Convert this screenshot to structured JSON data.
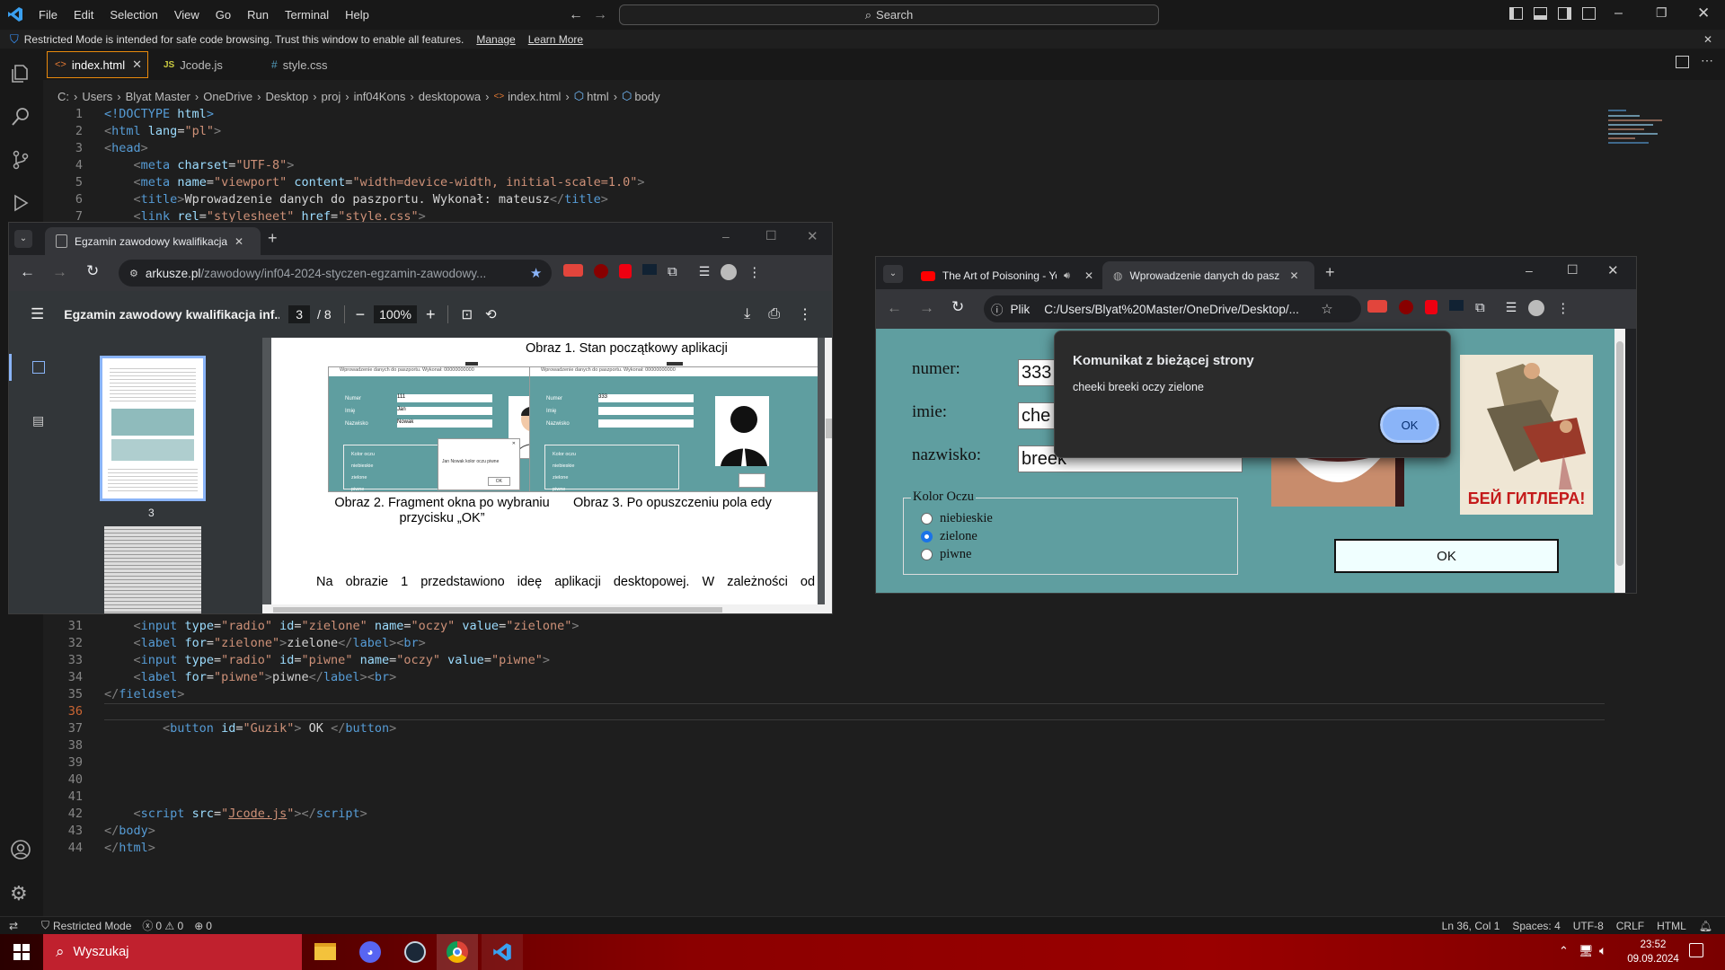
{
  "vscode": {
    "menu": [
      "File",
      "Edit",
      "Selection",
      "View",
      "Go",
      "Run",
      "Terminal",
      "Help"
    ],
    "search": "Search",
    "restricted_text": "Restricted Mode is intended for safe code browsing. Trust this window to enable all features.",
    "manage": "Manage",
    "learn_more": "Learn More",
    "tabs": [
      "index.html",
      "Jcode.js",
      "style.css"
    ],
    "breadcrumb": [
      "C:",
      "Users",
      "Blyat Master",
      "OneDrive",
      "Desktop",
      "proj",
      "inf04Kons",
      "desktopowa",
      "index.html",
      "html",
      "body"
    ],
    "status": {
      "restricted": "Restricted Mode",
      "problems": "0 ⚠ 0",
      "ports": "0",
      "position": "Ln 36, Col 1",
      "spaces": "Spaces: 4",
      "encoding": "UTF-8",
      "eol": "CRLF",
      "lang": "HTML"
    }
  },
  "code_top": [
    {
      "n": "1",
      "html": "<span class='kw'>&lt;!DOCTYPE</span> <span class='at'>html</span><span class='kw'>&gt;</span>"
    },
    {
      "n": "2",
      "html": "<span class='pu'>&lt;</span><span class='kw'>html</span> <span class='at'>lang</span>=<span class='st'>\"pl\"</span><span class='pu'>&gt;</span>"
    },
    {
      "n": "3",
      "html": "<span class='pu'>&lt;</span><span class='kw'>head</span><span class='pu'>&gt;</span>"
    },
    {
      "n": "4",
      "html": "    <span class='pu'>&lt;</span><span class='kw'>meta</span> <span class='at'>charset</span>=<span class='st'>\"UTF-8\"</span><span class='pu'>&gt;</span>"
    },
    {
      "n": "5",
      "html": "    <span class='pu'>&lt;</span><span class='kw'>meta</span> <span class='at'>name</span>=<span class='st'>\"viewport\"</span> <span class='at'>content</span>=<span class='st'>\"width=device-width, initial-scale=1.0\"</span><span class='pu'>&gt;</span>"
    },
    {
      "n": "6",
      "html": "    <span class='pu'>&lt;</span><span class='kw'>title</span><span class='pu'>&gt;</span><span class='tx'>Wprowadzenie danych do paszportu. Wykonał: mateusz</span><span class='pu'>&lt;/</span><span class='kw'>title</span><span class='pu'>&gt;</span>"
    },
    {
      "n": "7",
      "html": "    <span class='pu'>&lt;</span><span class='kw'>link</span> <span class='at'>rel</span>=<span class='st'>\"stylesheet\"</span> <span class='at'>href</span>=<span class='st'>\"style.css\"</span><span class='pu'>&gt;</span>"
    }
  ],
  "code_bottom": [
    {
      "n": "31",
      "html": "    <span class='pu'>&lt;</span><span class='kw'>input</span> <span class='at'>type</span>=<span class='st'>\"radio\"</span> <span class='at'>id</span>=<span class='st'>\"zielone\"</span> <span class='at'>name</span>=<span class='st'>\"oczy\"</span> <span class='at'>value</span>=<span class='st'>\"zielone\"</span><span class='pu'>&gt;</span>"
    },
    {
      "n": "32",
      "html": "    <span class='pu'>&lt;</span><span class='kw'>label</span> <span class='at'>for</span>=<span class='st'>\"zielone\"</span><span class='pu'>&gt;</span><span class='tx'>zielone</span><span class='pu'>&lt;/</span><span class='kw'>label</span><span class='pu'>&gt;&lt;</span><span class='kw'>br</span><span class='pu'>&gt;</span>"
    },
    {
      "n": "33",
      "html": "    <span class='pu'>&lt;</span><span class='kw'>input</span> <span class='at'>type</span>=<span class='st'>\"radio\"</span> <span class='at'>id</span>=<span class='st'>\"piwne\"</span> <span class='at'>name</span>=<span class='st'>\"oczy\"</span> <span class='at'>value</span>=<span class='st'>\"piwne\"</span><span class='pu'>&gt;</span>"
    },
    {
      "n": "34",
      "html": "    <span class='pu'>&lt;</span><span class='kw'>label</span> <span class='at'>for</span>=<span class='st'>\"piwne\"</span><span class='pu'>&gt;</span><span class='tx'>piwne</span><span class='pu'>&lt;/</span><span class='kw'>label</span><span class='pu'>&gt;&lt;</span><span class='kw'>br</span><span class='pu'>&gt;</span>"
    },
    {
      "n": "35",
      "html": "<span class='pu'>&lt;/</span><span class='kw'>fieldset</span><span class='pu'>&gt;</span>"
    },
    {
      "n": "36",
      "html": ""
    },
    {
      "n": "37",
      "html": "        <span class='pu'>&lt;</span><span class='kw'>button</span> <span class='at'>id</span>=<span class='st'>\"Guzik\"</span><span class='pu'>&gt;</span><span class='tx'> OK </span><span class='pu'>&lt;/</span><span class='kw'>button</span><span class='pu'>&gt;</span>"
    },
    {
      "n": "38",
      "html": ""
    },
    {
      "n": "39",
      "html": ""
    },
    {
      "n": "40",
      "html": ""
    },
    {
      "n": "41",
      "html": ""
    },
    {
      "n": "42",
      "html": "    <span class='pu'>&lt;</span><span class='kw'>script</span> <span class='at'>src</span>=<span class='st'>\"<u>Jcode.js</u>\"</span><span class='pu'>&gt;&lt;/</span><span class='kw'>script</span><span class='pu'>&gt;</span>"
    },
    {
      "n": "43",
      "html": "<span class='pu'>&lt;/</span><span class='kw'>body</span><span class='pu'>&gt;</span>"
    },
    {
      "n": "44",
      "html": "<span class='pu'>&lt;/</span><span class='kw'>html</span><span class='pu'>&gt;</span>"
    }
  ],
  "pdf": {
    "tab_title": "Egzamin zawodowy kwalifikacja",
    "url_host": "arkusze.pl",
    "url_path": "/zawodowy/inf04-2024-styczen-egzamin-zawodowy...",
    "doc_title": "Egzamin zawodowy kwalifikacja inf...",
    "page": "3",
    "pages": "/ 8",
    "zoom": "100%",
    "thumb_label": "3",
    "fig1": "Obraz 1. Stan początkowy aplikacji",
    "fig2a": "Obraz 2. Fragment okna po wybraniu",
    "fig2b": "przycisku „OK”",
    "fig3": "Obraz 3. Po opuszczeniu pola edy",
    "body": "Na obrazie 1 przedstawiono ideę aplikacji desktopowej. W zależności od",
    "mini": {
      "title": "Wprowadzenie danych do paszportu. Wykonał: 00000000000",
      "numer": "Numer",
      "imie": "Imię",
      "nazwisko": "Nazwisko",
      "v_num": "111",
      "v_imie": "Jan",
      "v_naz": "Nowak",
      "v_num3": "333",
      "kolor": "Kolor oczu",
      "opts": [
        "niebieskie",
        "zielone",
        "piwne"
      ],
      "dialog": "Jan Nowak kolor oczu piwne",
      "ok": "OK"
    }
  },
  "chrome": {
    "tab1": "The Art of Poisoning - YouT",
    "tab2": "Wprowadzenie danych do pasz",
    "plik": "Plik",
    "url": "C:/Users/Blyat%20Master/OneDrive/Desktop/...",
    "numer": "numer:",
    "imie": "imie:",
    "nazwisko": "nazwisko:",
    "v_numer": "333",
    "v_imie": "che",
    "v_nazwisko": "breek",
    "kolor": "Kolor Oczu",
    "opts": [
      "niebieskie",
      "zielone",
      "piwne"
    ],
    "ok": "OK",
    "poster_text": "БЕЙ ГИТЛЕРА!",
    "dialog": {
      "title": "Komunikat z bieżącej strony",
      "message": "cheeki breeki oczy zielone",
      "ok": "OK"
    }
  },
  "taskbar": {
    "search": "Wyszukaj",
    "time": "23:52",
    "date": "09.09.2024"
  }
}
